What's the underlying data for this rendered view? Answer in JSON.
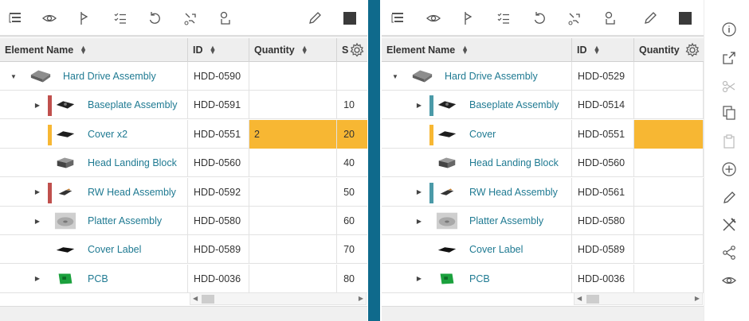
{
  "columns": {
    "name": "Element Name",
    "id": "ID",
    "quantity": "Quantity",
    "seq": "S"
  },
  "toolbar_icons": [
    "outline-icon",
    "eye-icon",
    "flag-icon",
    "checklist-icon",
    "undo-icon",
    "wrench-part-icon",
    "link-part-icon",
    "pencil-icon",
    "stop-square-icon"
  ],
  "side_rail_icons": [
    "info-icon",
    "export-icon",
    "scissors-icon",
    "copy-icon",
    "paste-icon",
    "add-circle-icon",
    "pencil-icon",
    "tools-icon",
    "share-icon",
    "eye-icon"
  ],
  "colors": {
    "accent": "#0f6a8c",
    "highlight": "#f7b733",
    "link": "#1f7a92",
    "red_marker": "#c0504d",
    "teal_marker": "#4b9aa8",
    "orange_marker": "#f7b733"
  },
  "left": {
    "rows": [
      {
        "name": "Hard Drive Assembly",
        "id": "HDD-0590",
        "qty": "",
        "seq": "",
        "level": 0,
        "expand": "open",
        "marker": "",
        "thumb": "hdd-icon",
        "highlight": false
      },
      {
        "name": "Baseplate Assembly",
        "id": "HDD-0591",
        "qty": "",
        "seq": "10",
        "level": 1,
        "expand": "closed",
        "marker": "red",
        "thumb": "baseplate-icon",
        "highlight": false
      },
      {
        "name": "Cover x2",
        "id": "HDD-0551",
        "qty": "2",
        "seq": "20",
        "level": 1,
        "expand": "",
        "marker": "orange",
        "thumb": "cover-icon",
        "highlight": true
      },
      {
        "name": "Head Landing Block",
        "id": "HDD-0560",
        "qty": "",
        "seq": "40",
        "level": 1,
        "expand": "",
        "marker": "",
        "thumb": "block-icon",
        "highlight": false
      },
      {
        "name": "RW Head Assembly",
        "id": "HDD-0592",
        "qty": "",
        "seq": "50",
        "level": 1,
        "expand": "closed",
        "marker": "red",
        "thumb": "rw-head-icon",
        "highlight": false
      },
      {
        "name": "Platter Assembly",
        "id": "HDD-0580",
        "qty": "",
        "seq": "60",
        "level": 1,
        "expand": "closed",
        "marker": "",
        "thumb": "platter-icon",
        "highlight": false
      },
      {
        "name": "Cover Label",
        "id": "HDD-0589",
        "qty": "",
        "seq": "70",
        "level": 1,
        "expand": "",
        "marker": "",
        "thumb": "label-icon",
        "highlight": false
      },
      {
        "name": "PCB",
        "id": "HDD-0036",
        "qty": "",
        "seq": "80",
        "level": 1,
        "expand": "closed",
        "marker": "",
        "thumb": "pcb-icon",
        "highlight": false
      }
    ]
  },
  "right": {
    "rows": [
      {
        "name": "Hard Drive Assembly",
        "id": "HDD-0529",
        "qty": "",
        "level": 0,
        "expand": "open",
        "marker": "",
        "thumb": "hdd-icon",
        "highlight": false
      },
      {
        "name": "Baseplate Assembly",
        "id": "HDD-0514",
        "qty": "",
        "level": 1,
        "expand": "closed",
        "marker": "teal",
        "thumb": "baseplate-icon",
        "highlight": false
      },
      {
        "name": "Cover",
        "id": "HDD-0551",
        "qty": "",
        "level": 1,
        "expand": "",
        "marker": "orange",
        "thumb": "cover-icon",
        "highlight": true
      },
      {
        "name": "Head Landing Block",
        "id": "HDD-0560",
        "qty": "",
        "level": 1,
        "expand": "",
        "marker": "",
        "thumb": "block-icon",
        "highlight": false
      },
      {
        "name": "RW Head Assembly",
        "id": "HDD-0561",
        "qty": "",
        "level": 1,
        "expand": "closed",
        "marker": "teal",
        "thumb": "rw-head-icon",
        "highlight": false
      },
      {
        "name": "Platter Assembly",
        "id": "HDD-0580",
        "qty": "",
        "level": 1,
        "expand": "closed",
        "marker": "",
        "thumb": "platter-icon",
        "highlight": false
      },
      {
        "name": "Cover Label",
        "id": "HDD-0589",
        "qty": "",
        "level": 1,
        "expand": "",
        "marker": "",
        "thumb": "label-icon",
        "highlight": false
      },
      {
        "name": "PCB",
        "id": "HDD-0036",
        "qty": "",
        "level": 1,
        "expand": "closed",
        "marker": "",
        "thumb": "pcb-icon",
        "highlight": false
      }
    ]
  }
}
